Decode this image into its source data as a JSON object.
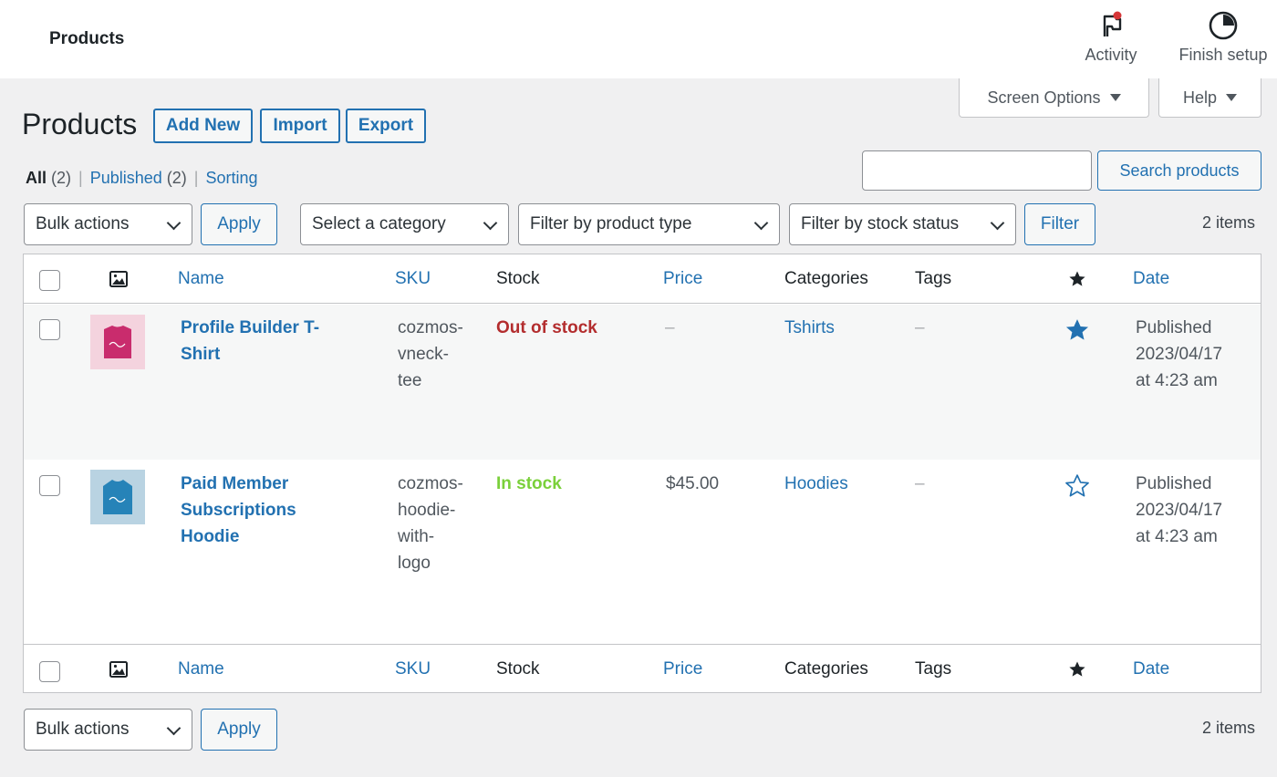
{
  "topbar": {
    "page_name": "Products",
    "activity_label": "Activity",
    "finish_label": "Finish setup"
  },
  "tabs": {
    "screen_options": "Screen Options",
    "help": "Help"
  },
  "heading": {
    "title": "Products",
    "add_new": "Add New",
    "import": "Import",
    "export": "Export"
  },
  "views": {
    "all_label": "All",
    "all_count": "(2)",
    "published_label": "Published",
    "published_count": "(2)",
    "sorting_label": "Sorting",
    "separator": "|"
  },
  "search": {
    "value": "",
    "button": "Search products"
  },
  "tablenav_top": {
    "bulk_actions": "Bulk actions",
    "apply": "Apply",
    "category": "Select a category",
    "product_type": "Filter by product type",
    "stock_status": "Filter by stock status",
    "filter": "Filter",
    "items": "2 items"
  },
  "columns": {
    "name": "Name",
    "sku": "SKU",
    "stock": "Stock",
    "price": "Price",
    "categories": "Categories",
    "tags": "Tags",
    "date": "Date"
  },
  "rows": [
    {
      "name_line1": "Profile Builder T-",
      "name_line2": "Shirt",
      "name_line3": "",
      "sku_line1": "cozmos-",
      "sku_line2": "vneck-",
      "sku_line3": "tee",
      "sku_line4": "",
      "stock": "Out of stock",
      "price": "–",
      "category": "Tshirts",
      "tags": "–",
      "featured": true,
      "date_line1": "Published",
      "date_line2": "2023/04/17",
      "date_line3": "at 4:23 am",
      "thumb_bg": "#f4d3de",
      "thumb_shirt": "#c92c6d"
    },
    {
      "name_line1": "Paid Member",
      "name_line2": "Subscriptions",
      "name_line3": "Hoodie",
      "sku_line1": "cozmos-",
      "sku_line2": "hoodie-",
      "sku_line3": "with-",
      "sku_line4": "logo",
      "stock": "In stock",
      "price": "$45.00",
      "category": "Hoodies",
      "tags": "–",
      "featured": false,
      "date_line1": "Published",
      "date_line2": "2023/04/17",
      "date_line3": "at 4:23 am",
      "thumb_bg": "#b9d3e2",
      "thumb_shirt": "#2683b8"
    }
  ],
  "tablenav_bottom": {
    "bulk_actions": "Bulk actions",
    "apply": "Apply",
    "items": "2 items"
  },
  "colors": {
    "accent": "#2271b1",
    "out_of_stock": "#b32d2e",
    "in_stock": "#7ad03a",
    "star": "#2271b1"
  }
}
